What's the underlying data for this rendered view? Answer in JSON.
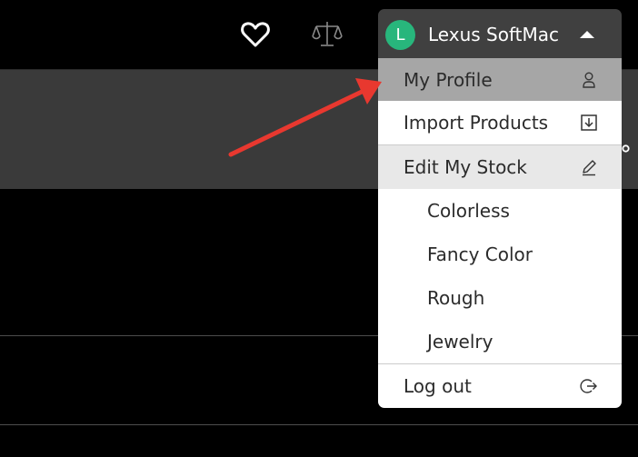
{
  "header": {
    "favorites_icon": "heart-icon",
    "compare_icon": "balance-scale-icon",
    "user": {
      "avatar_letter": "L",
      "name": "Lexus SoftMac",
      "avatar_color": "#28b67c",
      "caret_icon": "caret-up-icon"
    }
  },
  "menu": {
    "items": [
      {
        "label": "My Profile",
        "icon": "user-icon",
        "state": "hovered"
      },
      {
        "label": "Import Products",
        "icon": "download-icon"
      },
      {
        "label": "Edit My Stock",
        "icon": "pencil-icon",
        "state": "highlighted"
      },
      {
        "label": "Colorless"
      },
      {
        "label": "Fancy Color"
      },
      {
        "label": "Rough"
      },
      {
        "label": "Jewelry"
      },
      {
        "label": "Log out",
        "icon": "logout-icon"
      }
    ]
  },
  "annotation": {
    "arrow_color": "#e8382f"
  }
}
